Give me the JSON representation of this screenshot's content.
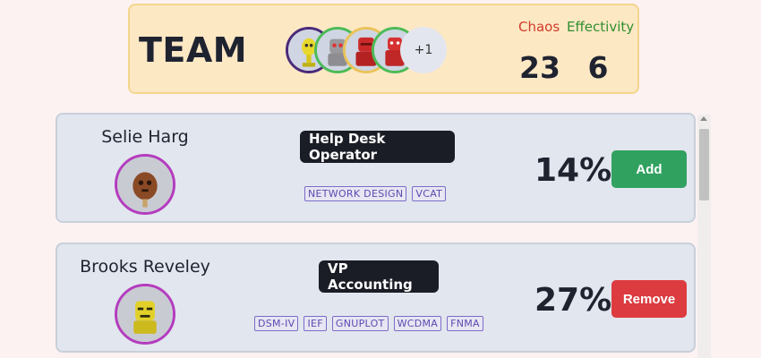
{
  "team": {
    "title": "TEAM",
    "more_count": "+1",
    "chaos_label": "Chaos",
    "chaos_value": "23",
    "effectivity_label": "Effectivity",
    "effectivity_value": "6"
  },
  "members": [
    {
      "name": "Selie Harg",
      "job": "Help Desk Operator",
      "skills": [
        "NETWORK DESIGN",
        "VCAT"
      ],
      "percent": "14%",
      "action": "Add"
    },
    {
      "name": "Brooks Reveley",
      "job": "VP Accounting",
      "skills": [
        "DSM-IV",
        "IEF",
        "GNUPLOT",
        "WCDMA",
        "FNMA"
      ],
      "percent": "27%",
      "action": "Remove"
    }
  ],
  "colors": {
    "chaos": "#d33a2c",
    "effectivity": "#2f8f2f",
    "add": "#31a160",
    "remove": "#dc3b40"
  }
}
